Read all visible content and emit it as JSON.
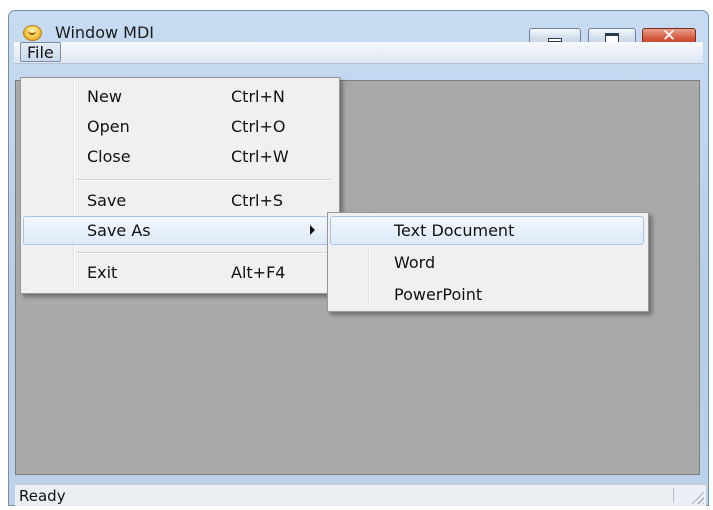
{
  "window": {
    "title": "Window MDI",
    "app_icon": "smiley-icon",
    "controls": {
      "minimize": "minimize-icon",
      "maximize": "maximize-icon",
      "close": "✕"
    }
  },
  "menu_bar": {
    "file_label": "File"
  },
  "file_menu": {
    "items": [
      {
        "label": "New",
        "shortcut": "Ctrl+N"
      },
      {
        "label": "Open",
        "shortcut": "Ctrl+O"
      },
      {
        "label": "Close",
        "shortcut": "Ctrl+W"
      },
      {
        "label": "Save",
        "shortcut": "Ctrl+S"
      },
      {
        "label": "Save As",
        "shortcut": "",
        "has_submenu": true,
        "highlighted": true
      },
      {
        "label": "Exit",
        "shortcut": "Alt+F4"
      }
    ]
  },
  "save_as_submenu": {
    "items": [
      {
        "label": "Text Document",
        "highlighted": true
      },
      {
        "label": "Word"
      },
      {
        "label": "PowerPoint"
      }
    ]
  },
  "status_bar": {
    "text": "Ready"
  },
  "colors": {
    "mdi_background": "#a9a9a9",
    "menu_background": "#f0f0f0",
    "highlight_border": "#a8c4e6",
    "close_button": "#c8452a"
  }
}
